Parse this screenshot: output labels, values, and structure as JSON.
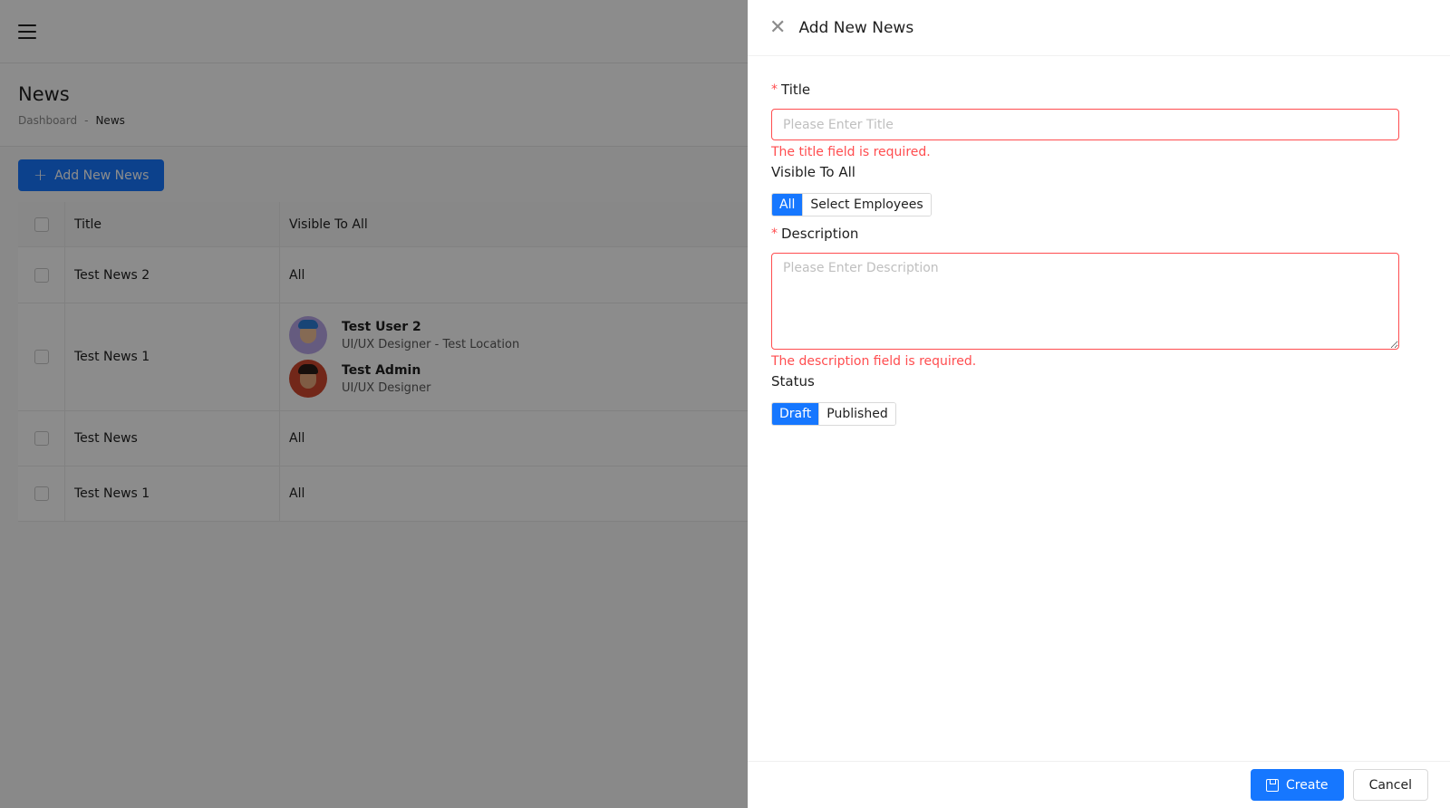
{
  "page": {
    "title": "News",
    "breadcrumb": {
      "parent": "Dashboard",
      "separator": "-",
      "current": "News"
    },
    "add_button_label": "Add New News",
    "table": {
      "columns": [
        "Title",
        "Visible To All"
      ],
      "rows": [
        {
          "title": "Test News 2",
          "visible": "All"
        },
        {
          "title": "Test News 1",
          "users": [
            {
              "name": "Test User 2",
              "role": "UI/UX Designer - Test Location"
            },
            {
              "name": "Test Admin",
              "role": "UI/UX Designer"
            }
          ]
        },
        {
          "title": "Test News",
          "visible": "All"
        },
        {
          "title": "Test News 1",
          "visible": "All"
        }
      ]
    }
  },
  "drawer": {
    "title": "Add New News",
    "fields": {
      "title": {
        "label": "Title",
        "placeholder": "Please Enter Title",
        "value": "",
        "error": "The title field is required."
      },
      "visible": {
        "label": "Visible To All",
        "options": [
          "All",
          "Select Employees"
        ],
        "selected": "All"
      },
      "description": {
        "label": "Description",
        "placeholder": "Please Enter Description",
        "value": "",
        "error": "The description field is required."
      },
      "status": {
        "label": "Status",
        "options": [
          "Draft",
          "Published"
        ],
        "selected": "Draft"
      }
    },
    "create_label": "Create",
    "cancel_label": "Cancel"
  },
  "colors": {
    "primary": "#1677ff",
    "error": "#ff4d4f",
    "overlay": "rgba(0,0,0,0.45)"
  }
}
